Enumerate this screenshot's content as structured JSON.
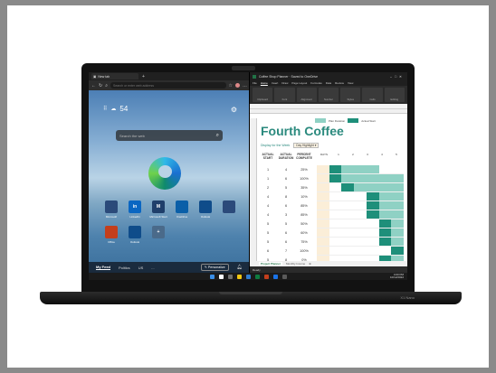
{
  "brand": "X1 Nano",
  "edge": {
    "tab_title": "New tab",
    "address_placeholder": "Search or enter web address",
    "weather_temp": "54",
    "search_placeholder": "Search the web",
    "tiles": [
      {
        "label": "Microsoft",
        "glyph": "",
        "color": "#2b4a7a"
      },
      {
        "label": "LinkedIn",
        "glyph": "in",
        "color": "#0a66c2"
      },
      {
        "label": "Microsoft Start",
        "glyph": "M",
        "color": "#1f3f6b"
      },
      {
        "label": "OneDrive",
        "glyph": "",
        "color": "#0a5fa8"
      },
      {
        "label": "Outlook",
        "glyph": "",
        "color": "#0f4c8a"
      },
      {
        "label": "",
        "glyph": "",
        "color": "#2b4a7a"
      },
      {
        "label": "Office",
        "glyph": "",
        "color": "#c43e1c"
      },
      {
        "label": "Outlook",
        "glyph": "",
        "color": "#0f4c8a"
      },
      {
        "label": "",
        "glyph": "+",
        "color": "#4a6a8a"
      }
    ],
    "feed_tabs": [
      "My Feed",
      "Politics",
      "US",
      "..."
    ],
    "personalize_label": "Personalize"
  },
  "excel": {
    "title": "Coffee Shop Planner · Saved to OneDrive",
    "menu": [
      "File",
      "Home",
      "Insert",
      "Draw",
      "Page Layout",
      "Formulas",
      "Data",
      "Review",
      "View"
    ],
    "ribbon_groups": [
      "Clipboard",
      "Font",
      "Alignment",
      "Number",
      "Styles",
      "Cells",
      "Editing"
    ],
    "heading": "Fourth Coffee",
    "legend": [
      {
        "label": "Plan Duration",
        "color": "#8fd1c4"
      },
      {
        "label": "Actual Start",
        "color": "#1e8f7a"
      }
    ],
    "filter_label": "Display for the Week",
    "filter_value": "Day Highlight",
    "columns": [
      "ACTUAL START",
      "ACTUAL DURATION",
      "PERCENT COMPLETE"
    ],
    "gantt_header": [
      "DAYS",
      "1",
      "2",
      "3",
      "4",
      "5"
    ],
    "rows": [
      {
        "start": "1",
        "duration": "4",
        "percent": "25%"
      },
      {
        "start": "1",
        "duration": "6",
        "percent": "100%"
      },
      {
        "start": "2",
        "duration": "5",
        "percent": "35%"
      },
      {
        "start": "4",
        "duration": "8",
        "percent": "10%"
      },
      {
        "start": "4",
        "duration": "6",
        "percent": "85%"
      },
      {
        "start": "4",
        "duration": "3",
        "percent": "85%"
      },
      {
        "start": "5",
        "duration": "5",
        "percent": "50%"
      },
      {
        "start": "5",
        "duration": "6",
        "percent": "60%"
      },
      {
        "start": "5",
        "duration": "6",
        "percent": "75%"
      },
      {
        "start": "6",
        "duration": "7",
        "percent": "100%"
      },
      {
        "start": "5",
        "duration": "8",
        "percent": "0%"
      }
    ],
    "sheet_tabs": [
      "Project Planner",
      "Monthly Income"
    ],
    "status": "Ready"
  },
  "taskbar": {
    "icons": [
      "#3a8ee6",
      "#ffffff",
      "#6e6e6e",
      "#f2c811",
      "#2d7dd2",
      "#0f7b3f",
      "#c43e1c",
      "#1a73e8",
      "#5a5a5a"
    ],
    "time": "4:00 PM",
    "date": "10/12/2022"
  }
}
